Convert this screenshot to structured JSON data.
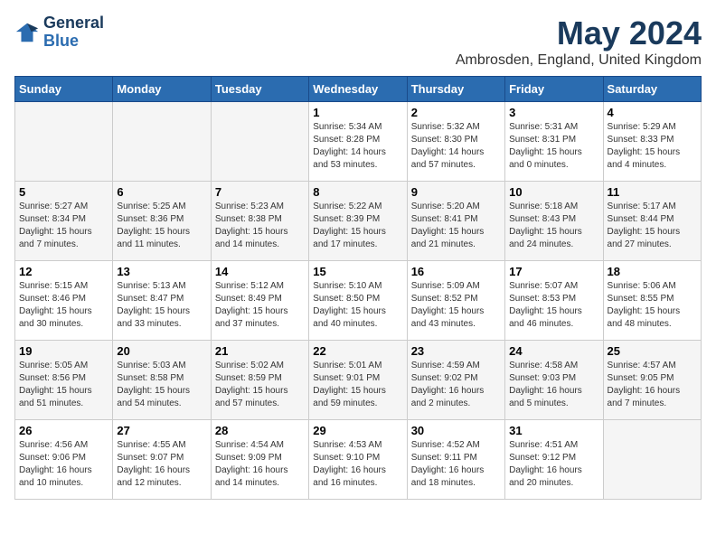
{
  "header": {
    "logo_line1": "General",
    "logo_line2": "Blue",
    "month_title": "May 2024",
    "location": "Ambrosden, England, United Kingdom"
  },
  "weekdays": [
    "Sunday",
    "Monday",
    "Tuesday",
    "Wednesday",
    "Thursday",
    "Friday",
    "Saturday"
  ],
  "weeks": [
    [
      {
        "day": "",
        "info": ""
      },
      {
        "day": "",
        "info": ""
      },
      {
        "day": "",
        "info": ""
      },
      {
        "day": "1",
        "info": "Sunrise: 5:34 AM\nSunset: 8:28 PM\nDaylight: 14 hours\nand 53 minutes."
      },
      {
        "day": "2",
        "info": "Sunrise: 5:32 AM\nSunset: 8:30 PM\nDaylight: 14 hours\nand 57 minutes."
      },
      {
        "day": "3",
        "info": "Sunrise: 5:31 AM\nSunset: 8:31 PM\nDaylight: 15 hours\nand 0 minutes."
      },
      {
        "day": "4",
        "info": "Sunrise: 5:29 AM\nSunset: 8:33 PM\nDaylight: 15 hours\nand 4 minutes."
      }
    ],
    [
      {
        "day": "5",
        "info": "Sunrise: 5:27 AM\nSunset: 8:34 PM\nDaylight: 15 hours\nand 7 minutes."
      },
      {
        "day": "6",
        "info": "Sunrise: 5:25 AM\nSunset: 8:36 PM\nDaylight: 15 hours\nand 11 minutes."
      },
      {
        "day": "7",
        "info": "Sunrise: 5:23 AM\nSunset: 8:38 PM\nDaylight: 15 hours\nand 14 minutes."
      },
      {
        "day": "8",
        "info": "Sunrise: 5:22 AM\nSunset: 8:39 PM\nDaylight: 15 hours\nand 17 minutes."
      },
      {
        "day": "9",
        "info": "Sunrise: 5:20 AM\nSunset: 8:41 PM\nDaylight: 15 hours\nand 21 minutes."
      },
      {
        "day": "10",
        "info": "Sunrise: 5:18 AM\nSunset: 8:43 PM\nDaylight: 15 hours\nand 24 minutes."
      },
      {
        "day": "11",
        "info": "Sunrise: 5:17 AM\nSunset: 8:44 PM\nDaylight: 15 hours\nand 27 minutes."
      }
    ],
    [
      {
        "day": "12",
        "info": "Sunrise: 5:15 AM\nSunset: 8:46 PM\nDaylight: 15 hours\nand 30 minutes."
      },
      {
        "day": "13",
        "info": "Sunrise: 5:13 AM\nSunset: 8:47 PM\nDaylight: 15 hours\nand 33 minutes."
      },
      {
        "day": "14",
        "info": "Sunrise: 5:12 AM\nSunset: 8:49 PM\nDaylight: 15 hours\nand 37 minutes."
      },
      {
        "day": "15",
        "info": "Sunrise: 5:10 AM\nSunset: 8:50 PM\nDaylight: 15 hours\nand 40 minutes."
      },
      {
        "day": "16",
        "info": "Sunrise: 5:09 AM\nSunset: 8:52 PM\nDaylight: 15 hours\nand 43 minutes."
      },
      {
        "day": "17",
        "info": "Sunrise: 5:07 AM\nSunset: 8:53 PM\nDaylight: 15 hours\nand 46 minutes."
      },
      {
        "day": "18",
        "info": "Sunrise: 5:06 AM\nSunset: 8:55 PM\nDaylight: 15 hours\nand 48 minutes."
      }
    ],
    [
      {
        "day": "19",
        "info": "Sunrise: 5:05 AM\nSunset: 8:56 PM\nDaylight: 15 hours\nand 51 minutes."
      },
      {
        "day": "20",
        "info": "Sunrise: 5:03 AM\nSunset: 8:58 PM\nDaylight: 15 hours\nand 54 minutes."
      },
      {
        "day": "21",
        "info": "Sunrise: 5:02 AM\nSunset: 8:59 PM\nDaylight: 15 hours\nand 57 minutes."
      },
      {
        "day": "22",
        "info": "Sunrise: 5:01 AM\nSunset: 9:01 PM\nDaylight: 15 hours\nand 59 minutes."
      },
      {
        "day": "23",
        "info": "Sunrise: 4:59 AM\nSunset: 9:02 PM\nDaylight: 16 hours\nand 2 minutes."
      },
      {
        "day": "24",
        "info": "Sunrise: 4:58 AM\nSunset: 9:03 PM\nDaylight: 16 hours\nand 5 minutes."
      },
      {
        "day": "25",
        "info": "Sunrise: 4:57 AM\nSunset: 9:05 PM\nDaylight: 16 hours\nand 7 minutes."
      }
    ],
    [
      {
        "day": "26",
        "info": "Sunrise: 4:56 AM\nSunset: 9:06 PM\nDaylight: 16 hours\nand 10 minutes."
      },
      {
        "day": "27",
        "info": "Sunrise: 4:55 AM\nSunset: 9:07 PM\nDaylight: 16 hours\nand 12 minutes."
      },
      {
        "day": "28",
        "info": "Sunrise: 4:54 AM\nSunset: 9:09 PM\nDaylight: 16 hours\nand 14 minutes."
      },
      {
        "day": "29",
        "info": "Sunrise: 4:53 AM\nSunset: 9:10 PM\nDaylight: 16 hours\nand 16 minutes."
      },
      {
        "day": "30",
        "info": "Sunrise: 4:52 AM\nSunset: 9:11 PM\nDaylight: 16 hours\nand 18 minutes."
      },
      {
        "day": "31",
        "info": "Sunrise: 4:51 AM\nSunset: 9:12 PM\nDaylight: 16 hours\nand 20 minutes."
      },
      {
        "day": "",
        "info": ""
      }
    ]
  ]
}
